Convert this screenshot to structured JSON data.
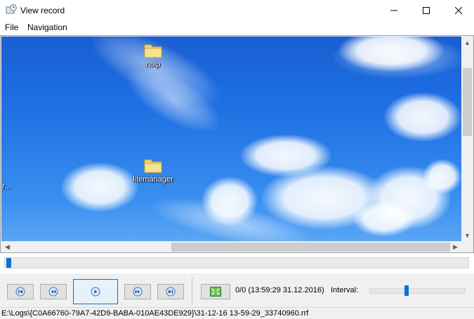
{
  "window": {
    "title": "View record",
    "icon": "record-clock-icon",
    "controls": [
      "minimize-icon",
      "maximize-icon",
      "close-icon"
    ]
  },
  "menu": {
    "file": "File",
    "navigation": "Navigation"
  },
  "viewer": {
    "desktop_icons": [
      {
        "label": "noip",
        "icon": "folder-icon"
      },
      {
        "label": "litemanager",
        "icon": "folder-icon"
      }
    ],
    "edge_label": "r..."
  },
  "timeline": {
    "position": 0
  },
  "controls": {
    "buttons": [
      "skip-to-start-icon",
      "rewind-icon",
      "play-icon",
      "fast-forward-icon",
      "skip-to-end-icon",
      "fit-screen-icon"
    ],
    "status": "0/0 (13:59:29 31.12.2016)",
    "interval_label": "Interval:",
    "interval_value": 0.38
  },
  "statusbar": {
    "path": "E:\\Logs\\{C0A66760-79A7-42D9-BABA-010AE43DE929}\\31-12-16 13-59-29_33740960.rrf"
  },
  "colors": {
    "accent": "#0a72d4",
    "sky": "#1c6ae0",
    "folder": "#f5d36b"
  }
}
